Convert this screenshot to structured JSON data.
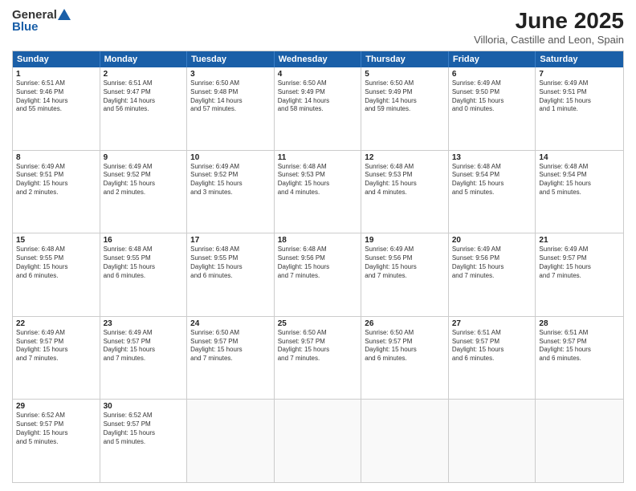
{
  "logo": {
    "general": "General",
    "blue": "Blue"
  },
  "title": {
    "month": "June 2025",
    "location": "Villoria, Castille and Leon, Spain"
  },
  "header": {
    "days": [
      "Sunday",
      "Monday",
      "Tuesday",
      "Wednesday",
      "Thursday",
      "Friday",
      "Saturday"
    ]
  },
  "rows": [
    [
      {
        "day": "",
        "content": ""
      },
      {
        "day": "2",
        "content": "Sunrise: 6:51 AM\nSunset: 9:47 PM\nDaylight: 14 hours\nand 56 minutes."
      },
      {
        "day": "3",
        "content": "Sunrise: 6:50 AM\nSunset: 9:48 PM\nDaylight: 14 hours\nand 57 minutes."
      },
      {
        "day": "4",
        "content": "Sunrise: 6:50 AM\nSunset: 9:49 PM\nDaylight: 14 hours\nand 58 minutes."
      },
      {
        "day": "5",
        "content": "Sunrise: 6:50 AM\nSunset: 9:49 PM\nDaylight: 14 hours\nand 59 minutes."
      },
      {
        "day": "6",
        "content": "Sunrise: 6:49 AM\nSunset: 9:50 PM\nDaylight: 15 hours\nand 0 minutes."
      },
      {
        "day": "7",
        "content": "Sunrise: 6:49 AM\nSunset: 9:51 PM\nDaylight: 15 hours\nand 1 minute."
      }
    ],
    [
      {
        "day": "1",
        "content": "Sunrise: 6:51 AM\nSunset: 9:46 PM\nDaylight: 14 hours\nand 55 minutes."
      },
      {
        "day": "9",
        "content": "Sunrise: 6:49 AM\nSunset: 9:52 PM\nDaylight: 15 hours\nand 2 minutes."
      },
      {
        "day": "10",
        "content": "Sunrise: 6:49 AM\nSunset: 9:52 PM\nDaylight: 15 hours\nand 3 minutes."
      },
      {
        "day": "11",
        "content": "Sunrise: 6:48 AM\nSunset: 9:53 PM\nDaylight: 15 hours\nand 4 minutes."
      },
      {
        "day": "12",
        "content": "Sunrise: 6:48 AM\nSunset: 9:53 PM\nDaylight: 15 hours\nand 4 minutes."
      },
      {
        "day": "13",
        "content": "Sunrise: 6:48 AM\nSunset: 9:54 PM\nDaylight: 15 hours\nand 5 minutes."
      },
      {
        "day": "14",
        "content": "Sunrise: 6:48 AM\nSunset: 9:54 PM\nDaylight: 15 hours\nand 5 minutes."
      }
    ],
    [
      {
        "day": "8",
        "content": "Sunrise: 6:49 AM\nSunset: 9:51 PM\nDaylight: 15 hours\nand 2 minutes."
      },
      {
        "day": "16",
        "content": "Sunrise: 6:48 AM\nSunset: 9:55 PM\nDaylight: 15 hours\nand 6 minutes."
      },
      {
        "day": "17",
        "content": "Sunrise: 6:48 AM\nSunset: 9:55 PM\nDaylight: 15 hours\nand 6 minutes."
      },
      {
        "day": "18",
        "content": "Sunrise: 6:48 AM\nSunset: 9:56 PM\nDaylight: 15 hours\nand 7 minutes."
      },
      {
        "day": "19",
        "content": "Sunrise: 6:49 AM\nSunset: 9:56 PM\nDaylight: 15 hours\nand 7 minutes."
      },
      {
        "day": "20",
        "content": "Sunrise: 6:49 AM\nSunset: 9:56 PM\nDaylight: 15 hours\nand 7 minutes."
      },
      {
        "day": "21",
        "content": "Sunrise: 6:49 AM\nSunset: 9:57 PM\nDaylight: 15 hours\nand 7 minutes."
      }
    ],
    [
      {
        "day": "15",
        "content": "Sunrise: 6:48 AM\nSunset: 9:55 PM\nDaylight: 15 hours\nand 6 minutes."
      },
      {
        "day": "23",
        "content": "Sunrise: 6:49 AM\nSunset: 9:57 PM\nDaylight: 15 hours\nand 7 minutes."
      },
      {
        "day": "24",
        "content": "Sunrise: 6:50 AM\nSunset: 9:57 PM\nDaylight: 15 hours\nand 7 minutes."
      },
      {
        "day": "25",
        "content": "Sunrise: 6:50 AM\nSunset: 9:57 PM\nDaylight: 15 hours\nand 7 minutes."
      },
      {
        "day": "26",
        "content": "Sunrise: 6:50 AM\nSunset: 9:57 PM\nDaylight: 15 hours\nand 6 minutes."
      },
      {
        "day": "27",
        "content": "Sunrise: 6:51 AM\nSunset: 9:57 PM\nDaylight: 15 hours\nand 6 minutes."
      },
      {
        "day": "28",
        "content": "Sunrise: 6:51 AM\nSunset: 9:57 PM\nDaylight: 15 hours\nand 6 minutes."
      }
    ],
    [
      {
        "day": "22",
        "content": "Sunrise: 6:49 AM\nSunset: 9:57 PM\nDaylight: 15 hours\nand 7 minutes."
      },
      {
        "day": "30",
        "content": "Sunrise: 6:52 AM\nSunset: 9:57 PM\nDaylight: 15 hours\nand 5 minutes."
      },
      {
        "day": "",
        "content": ""
      },
      {
        "day": "",
        "content": ""
      },
      {
        "day": "",
        "content": ""
      },
      {
        "day": "",
        "content": ""
      },
      {
        "day": "",
        "content": ""
      }
    ],
    [
      {
        "day": "29",
        "content": "Sunrise: 6:52 AM\nSunset: 9:57 PM\nDaylight: 15 hours\nand 5 minutes."
      },
      {
        "day": "",
        "content": ""
      },
      {
        "day": "",
        "content": ""
      },
      {
        "day": "",
        "content": ""
      },
      {
        "day": "",
        "content": ""
      },
      {
        "day": "",
        "content": ""
      },
      {
        "day": "",
        "content": ""
      }
    ]
  ]
}
